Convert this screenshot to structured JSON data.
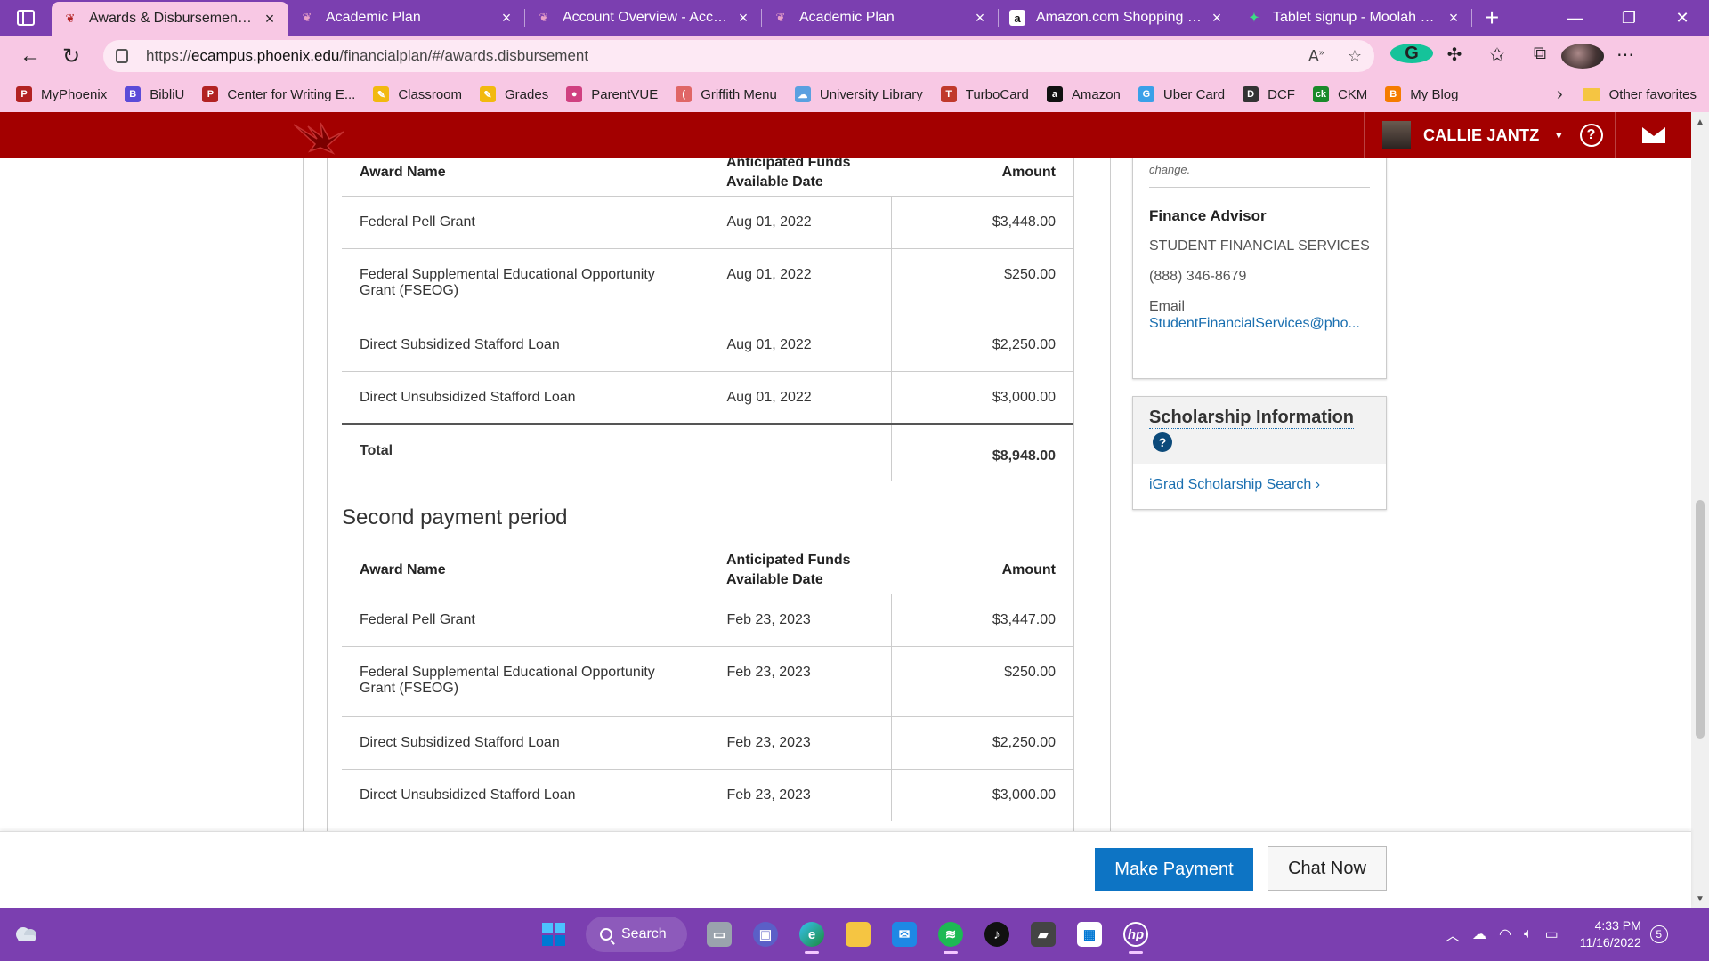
{
  "browser": {
    "tabs": [
      {
        "label": "Awards & Disbursements - ",
        "favicon": "phoenix-icon",
        "active": true
      },
      {
        "label": "Academic Plan",
        "favicon": "phoenix-icon",
        "active": false
      },
      {
        "label": "Account Overview - Accoun",
        "favicon": "phoenix-icon",
        "active": false
      },
      {
        "label": "Academic Plan",
        "favicon": "phoenix-icon",
        "active": false
      },
      {
        "label": "Amazon.com Shopping Car",
        "favicon": "amazon-icon",
        "active": false
      },
      {
        "label": "Tablet signup - Moolah Wir",
        "favicon": "moolah-icon",
        "active": false
      }
    ],
    "url_prefix": "https://",
    "url_host": "ecampus.phoenix.edu",
    "url_path": "/financialplan/#/awards.disbursement",
    "favorites": [
      {
        "label": "MyPhoenix",
        "color": "#b22222",
        "glyph": "P"
      },
      {
        "label": "BibliU",
        "color": "#5b4bd8",
        "glyph": "B"
      },
      {
        "label": "Center for Writing E...",
        "color": "#b22222",
        "glyph": "P"
      },
      {
        "label": "Classroom",
        "color": "#f2b90f",
        "glyph": "✎"
      },
      {
        "label": "Grades",
        "color": "#f2b90f",
        "glyph": "✎"
      },
      {
        "label": "ParentVUE",
        "color": "#d04080",
        "glyph": "●"
      },
      {
        "label": "Griffith Menu",
        "color": "#e06666",
        "glyph": "("
      },
      {
        "label": "University Library",
        "color": "#5aa0e0",
        "glyph": "☁"
      },
      {
        "label": "TurboCard",
        "color": "#c0392b",
        "glyph": "T"
      },
      {
        "label": "Amazon",
        "color": "#111111",
        "glyph": "a"
      },
      {
        "label": "Uber Card",
        "color": "#3aa0e8",
        "glyph": "G"
      },
      {
        "label": "DCF",
        "color": "#333333",
        "glyph": "D"
      },
      {
        "label": "CKM",
        "color": "#1a8a2a",
        "glyph": "ck"
      },
      {
        "label": "My Blog",
        "color": "#f57c00",
        "glyph": "B"
      }
    ],
    "other_favorites": "Other favorites"
  },
  "header": {
    "user_name": "CALLIE JANTZ",
    "help_glyph": "?"
  },
  "first_period": {
    "columns": [
      "Award Name",
      "Anticipated Funds Available Date",
      "Amount"
    ],
    "rows": [
      {
        "name": "Federal Pell Grant",
        "date": "Aug 01, 2022",
        "amount": "$3,448.00"
      },
      {
        "name": "Federal Supplemental Educational Opportunity Grant (FSEOG)",
        "date": "Aug 01, 2022",
        "amount": "$250.00"
      },
      {
        "name": "Direct Subsidized Stafford Loan",
        "date": "Aug 01, 2022",
        "amount": "$2,250.00"
      },
      {
        "name": "Direct Unsubsidized Stafford Loan",
        "date": "Aug 01, 2022",
        "amount": "$3,000.00"
      }
    ],
    "total_label": "Total",
    "total_amount": "$8,948.00"
  },
  "second_period": {
    "title": "Second payment period",
    "columns": [
      "Award Name",
      "Anticipated Funds Available Date",
      "Amount"
    ],
    "rows": [
      {
        "name": "Federal Pell Grant",
        "date": "Feb 23, 2023",
        "amount": "$3,447.00"
      },
      {
        "name": "Federal Supplemental Educational Opportunity Grant (FSEOG)",
        "date": "Feb 23, 2023",
        "amount": "$250.00"
      },
      {
        "name": "Direct Subsidized Stafford Loan",
        "date": "Feb 23, 2023",
        "amount": "$2,250.00"
      },
      {
        "name": "Direct Unsubsidized Stafford Loan",
        "date": "Feb 23, 2023",
        "amount": "$3,000.00"
      }
    ]
  },
  "sidebar": {
    "change_note": "change.",
    "advisor_title": "Finance Advisor",
    "advisor_org": "STUDENT FINANCIAL SERVICES",
    "advisor_phone": "(888) 346-8679",
    "email_label": "Email",
    "email_value": "StudentFinancialServices@pho...",
    "scholarship_title": "Scholarship Information",
    "scholarship_help": "?",
    "scholarship_link": "iGrad Scholarship Search ›"
  },
  "actions": {
    "make_payment": "Make Payment",
    "chat_now": "Chat Now"
  },
  "taskbar": {
    "search_label": "Search",
    "time": "4:33 PM",
    "date": "11/16/2022",
    "notifications": "5"
  }
}
